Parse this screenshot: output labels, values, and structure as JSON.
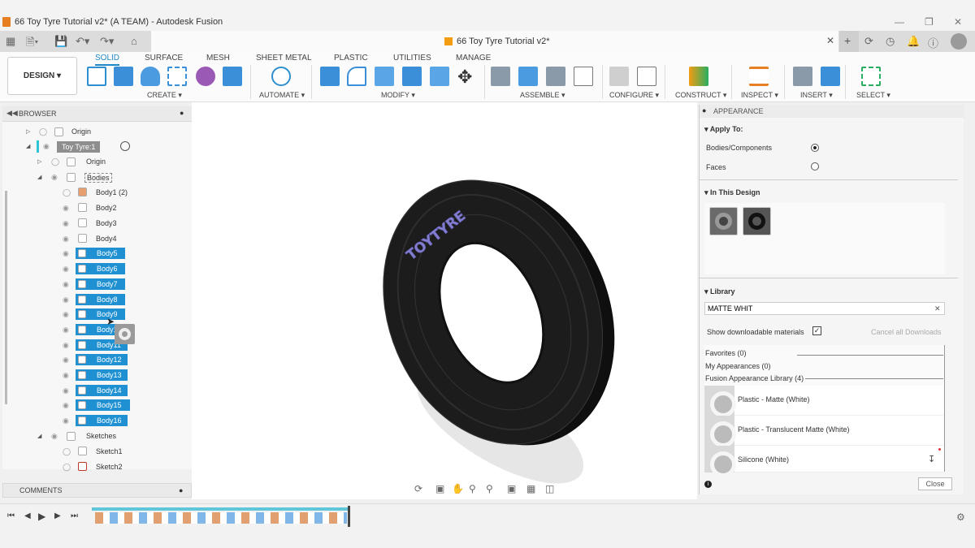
{
  "window": {
    "title": "66 Toy Tyre Tutorial v2* (A TEAM) - Autodesk Fusion"
  },
  "doc_tab": {
    "title": "66 Toy Tyre Tutorial v2*"
  },
  "design_button": "DESIGN",
  "ribbon_tabs": [
    "SOLID",
    "SURFACE",
    "MESH",
    "SHEET METAL",
    "PLASTIC",
    "UTILITIES",
    "MANAGE"
  ],
  "ribbon_groups": [
    "CREATE",
    "AUTOMATE",
    "MODIFY",
    "ASSEMBLE",
    "CONFIGURE",
    "CONSTRUCT",
    "INSPECT",
    "INSERT",
    "SELECT"
  ],
  "browser": {
    "title": "BROWSER",
    "items": {
      "origin_root": "Origin",
      "component": "Toy Tyre:1",
      "origin": "Origin",
      "bodies": "Bodies",
      "body1": "Body1 (2)",
      "body2": "Body2",
      "body3": "Body3",
      "body4": "Body4",
      "body5": "Body5",
      "body6": "Body6",
      "body7": "Body7",
      "body8": "Body8",
      "body9": "Body9",
      "body10": "Body10",
      "body11": "Body11",
      "body12": "Body12",
      "body13": "Body13",
      "body14": "Body14",
      "body15": "Body15",
      "body16": "Body16",
      "sketches": "Sketches",
      "sketch1": "Sketch1",
      "sketch2": "Sketch2"
    }
  },
  "comments": {
    "title": "COMMENTS"
  },
  "appearance": {
    "title": "APPEARANCE",
    "apply_to": {
      "heading": "Apply To:",
      "options": [
        "Bodies/Components",
        "Faces"
      ],
      "selected": "Bodies/Components"
    },
    "in_this_design": {
      "heading": "In This Design"
    },
    "library": {
      "heading": "Library",
      "search_value": "MATTE WHIT",
      "show_downloadable_label": "Show downloadable materials",
      "show_downloadable_checked": true,
      "cancel_downloads_label": "Cancel all Downloads",
      "sections": [
        "Favorites (0)",
        "My Appearances (0)",
        "Fusion Appearance Library (4)"
      ],
      "items": [
        "Plastic - Matte (White)",
        "Plastic - Translucent Matte (White)",
        "Silicone (White)"
      ]
    },
    "close_label": "Close"
  },
  "colors": {
    "accent": "#1e88c8",
    "selection": "#1f90d2",
    "tyre": "#1c1c1c"
  }
}
